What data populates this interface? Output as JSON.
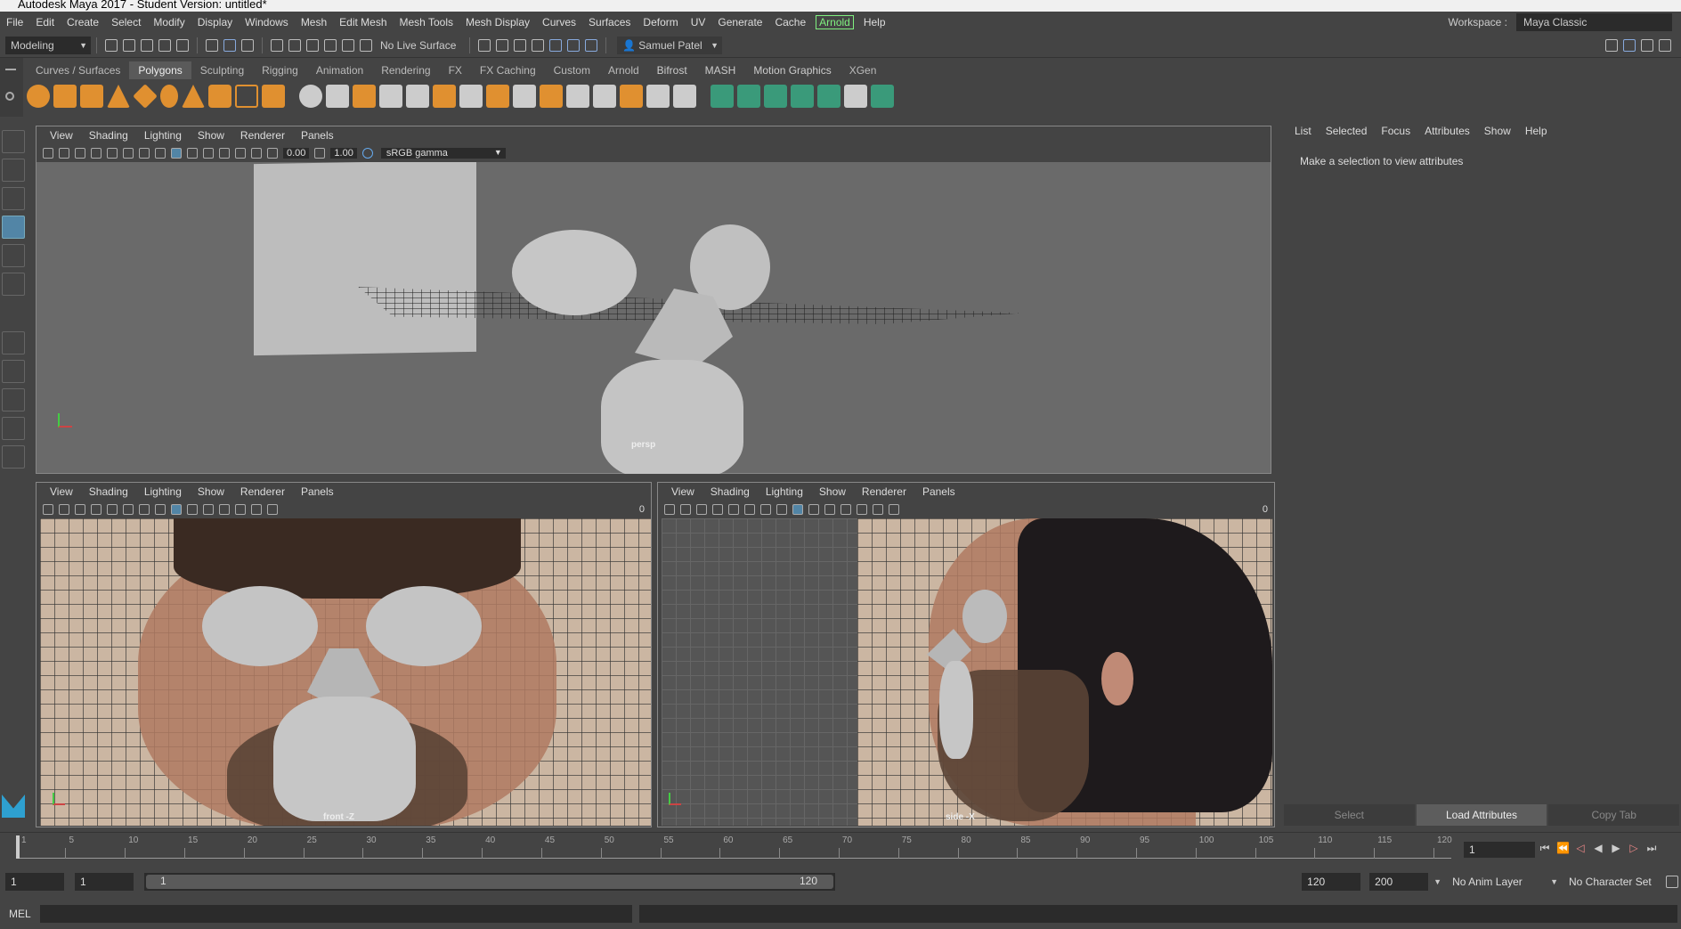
{
  "window": {
    "title": "Autodesk Maya 2017 - Student Version: untitled*"
  },
  "menubar": {
    "items": [
      "File",
      "Edit",
      "Create",
      "Select",
      "Modify",
      "Display",
      "Windows",
      "Mesh",
      "Edit Mesh",
      "Mesh Tools",
      "Mesh Display",
      "Curves",
      "Surfaces",
      "Deform",
      "UV",
      "Generate",
      "Cache",
      "Arnold",
      "Help"
    ],
    "highlight": "Arnold",
    "workspace_label": "Workspace :",
    "workspace_value": "Maya Classic"
  },
  "statusline": {
    "mode": "Modeling",
    "live_surface": "No Live Surface",
    "user": "Samuel Patel"
  },
  "shelf": {
    "tabs": [
      "Curves / Surfaces",
      "Polygons",
      "Sculpting",
      "Rigging",
      "Animation",
      "Rendering",
      "FX",
      "FX Caching",
      "Custom",
      "Arnold",
      "Bifrost",
      "MASH",
      "Motion Graphics",
      "XGen"
    ],
    "active": "Polygons"
  },
  "viewports": {
    "menu": [
      "View",
      "Shading",
      "Lighting",
      "Show",
      "Renderer",
      "Panels"
    ],
    "persp": {
      "label": "persp",
      "exposure": "0.00",
      "gamma": "1.00",
      "colorspace": "sRGB gamma"
    },
    "front": {
      "label": "front -Z",
      "field": "0"
    },
    "side": {
      "label": "side -X",
      "field": "0"
    }
  },
  "attribute_editor": {
    "menu": [
      "List",
      "Selected",
      "Focus",
      "Attributes",
      "Show",
      "Help"
    ],
    "message": "Make a selection to view attributes",
    "buttons": [
      "Select",
      "Load Attributes",
      "Copy Tab"
    ],
    "active_button": "Load Attributes"
  },
  "timeline": {
    "ticks": [
      "1",
      "5",
      "10",
      "15",
      "20",
      "25",
      "30",
      "35",
      "40",
      "45",
      "50",
      "55",
      "60",
      "65",
      "70",
      "75",
      "80",
      "85",
      "90",
      "95",
      "100",
      "105",
      "110",
      "115",
      "120"
    ],
    "current_frame": "1"
  },
  "range": {
    "start": "1",
    "start_inner": "1",
    "slider_start": "1",
    "slider_end": "120",
    "end_inner": "120",
    "end": "200",
    "anim_layer": "No Anim Layer",
    "char_set": "No Character Set"
  },
  "command": {
    "label": "MEL"
  },
  "colors": {
    "selected_tool": "#5285a6",
    "arnold_highlight": "#7ff07f",
    "shelf_orange": "#e09030",
    "shelf_teal": "#3a9a7a"
  }
}
